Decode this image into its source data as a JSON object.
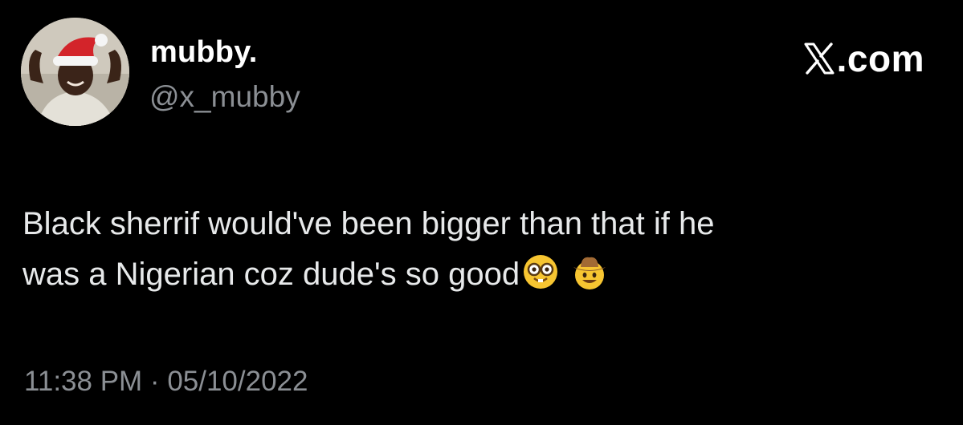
{
  "author": {
    "display_name": "mubby.",
    "handle": "@x_mubby",
    "avatar_icon": "profile-avatar"
  },
  "brand": {
    "label": ".com",
    "icon": "x-logo-icon",
    "full": "X.com"
  },
  "tweet": {
    "line1": "Black sherrif would've been bigger than that if he",
    "line2": "was a Nigerian coz dude's so good",
    "emojis": [
      "nerd-face-emoji",
      "cowboy-hat-face-emoji"
    ]
  },
  "meta": {
    "timestamp": "11:38 PM · 05/10/2022"
  },
  "colors": {
    "background": "#000000",
    "primary_text": "#e7e9ea",
    "secondary_text": "#8b8f94"
  }
}
